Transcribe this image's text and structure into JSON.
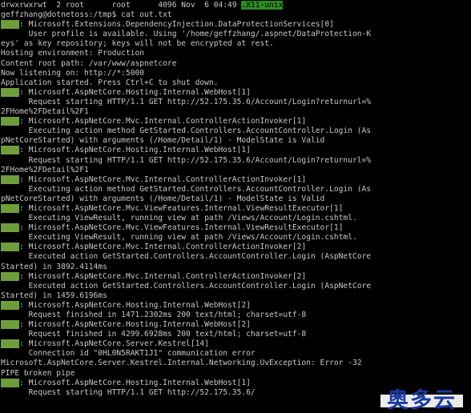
{
  "colors": {
    "background": "#000000",
    "text": "#c8c8c8",
    "info_badge": "#6e9e3c",
    "highlight": "#2e8b24",
    "watermark": "#1a3aa0"
  },
  "terminal": {
    "lines": [
      "drwxrwxrwt  2 root      root      4096 Nov  6 04:49 ",
      "geffzhang@dotnetoss:/tmp$ cat out.txt",
      "info: Microsoft.Extensions.DependencyInjection.DataProtectionServices[0]",
      "      User profile is available. Using '/home/geffzhang/.aspnet/DataProtection-K",
      "eys' as key repository; keys will not be encrypted at rest.",
      "Hosting environment: Production",
      "Content root path: /var/www/aspnetcore",
      "Now listening on: http://*:5000",
      "Application started. Press Ctrl+C to shut down.",
      "info: Microsoft.AspNetCore.Hosting.Internal.WebHost[1]",
      "      Request starting HTTP/1.1 GET http://52.175.35.6/Account/Login?returnurl=%",
      "2FHome%2FDetail%2F1",
      "info: Microsoft.AspNetCore.Mvc.Internal.ControllerActionInvoker[1]",
      "      Executing action method GetStarted.Controllers.AccountController.Login (As",
      "pNetCoreStarted) with arguments (/Home/Detail/1) - ModelState is Valid",
      "info: Microsoft.AspNetCore.Hosting.Internal.WebHost[1]",
      "      Request starting HTTP/1.1 GET http://52.175.35.6/Account/Login?returnurl=%",
      "2FHome%2FDetail%2F1",
      "info: Microsoft.AspNetCore.Mvc.Internal.ControllerActionInvoker[1]",
      "      Executing action method GetStarted.Controllers.AccountController.Login (As",
      "pNetCoreStarted) with arguments (/Home/Detail/1) - ModelState is Valid",
      "info: Microsoft.AspNetCore.Mvc.ViewFeatures.Internal.ViewResultExecutor[1]",
      "      Executing ViewResult, running view at path /Views/Account/Login.cshtml.",
      "info: Microsoft.AspNetCore.Mvc.ViewFeatures.Internal.ViewResultExecutor[1]",
      "      Executing ViewResult, running view at path /Views/Account/Login.cshtml.",
      "info: Microsoft.AspNetCore.Mvc.Internal.ControllerActionInvoker[2]",
      "      Executed action GetStarted.Controllers.AccountController.Login (AspNetCore",
      "Started) in 3892.4114ms",
      "info: Microsoft.AspNetCore.Mvc.Internal.ControllerActionInvoker[2]",
      "      Executed action GetStarted.Controllers.AccountController.Login (AspNetCore",
      "Started) in 1459.6196ms",
      "info: Microsoft.AspNetCore.Hosting.Internal.WebHost[2]",
      "      Request finished in 1471.2302ms 200 text/html; charset=utf-8",
      "info: Microsoft.AspNetCore.Hosting.Internal.WebHost[2]",
      "      Request finished in 4299.6928ms 200 text/html; charset=utf-8",
      "info: Microsoft.AspNetCore.Server.Kestrel[14]",
      "      Connection id \"0HL0N5RAKT1J1\" communication error",
      "Microsoft.AspNetCore.Server.Kestrel.Internal.Networking.UvException: Error -32",
      "PIPE broken pipe",
      "info: Microsoft.AspNetCore.Hosting.Internal.WebHost[1]",
      "      Request starting HTTP/1.1 GET http://52.175.35.6/"
    ],
    "highlight_text": ".X11-unix",
    "info_label": "info"
  },
  "watermark": {
    "text": "奥多云"
  }
}
